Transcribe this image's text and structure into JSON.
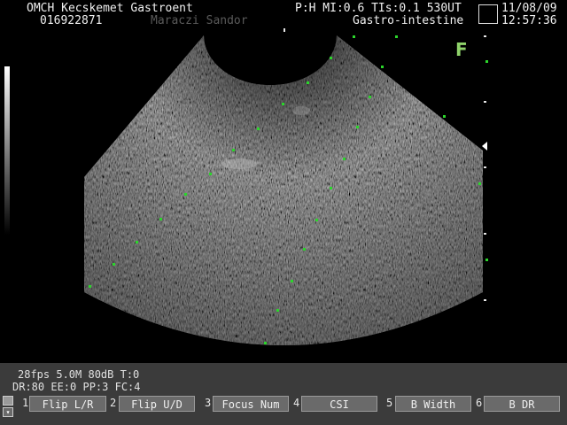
{
  "header": {
    "institution": "OMCH Kecskemet Gastroent",
    "patient_id": "016922871",
    "patient_name": "Maraczi Sandor",
    "probe_params": "P:H  MI:0.6  TIs:0.1  530UT",
    "exam_preset": "Gastro-intestine",
    "date": "11/08/09",
    "time": "12:57:36"
  },
  "orientation_mark": "F",
  "status": {
    "line1": "28fps  5.0M  80dB  T:0",
    "line2": "DR:80 EE:0  PP:3 FC:4"
  },
  "softkeys": [
    {
      "num": "1",
      "label": "Flip L/R"
    },
    {
      "num": "2",
      "label": "Flip U/D"
    },
    {
      "num": "3",
      "label": "Focus Num"
    },
    {
      "num": "4",
      "label": "CSI"
    },
    {
      "num": "5",
      "label": "B Width"
    },
    {
      "num": "6",
      "label": "B DR"
    }
  ],
  "colors": {
    "background": "#000000",
    "panel": "#3b3b3b",
    "softkey": "#6a6a6a",
    "orientation_green": "#8fd36a",
    "speckle_green": "#2bd62b"
  },
  "icons": {
    "focus_marker": "triangle-left-icon",
    "panel_icons": [
      "square-icon",
      "chevron-down-icon"
    ]
  }
}
